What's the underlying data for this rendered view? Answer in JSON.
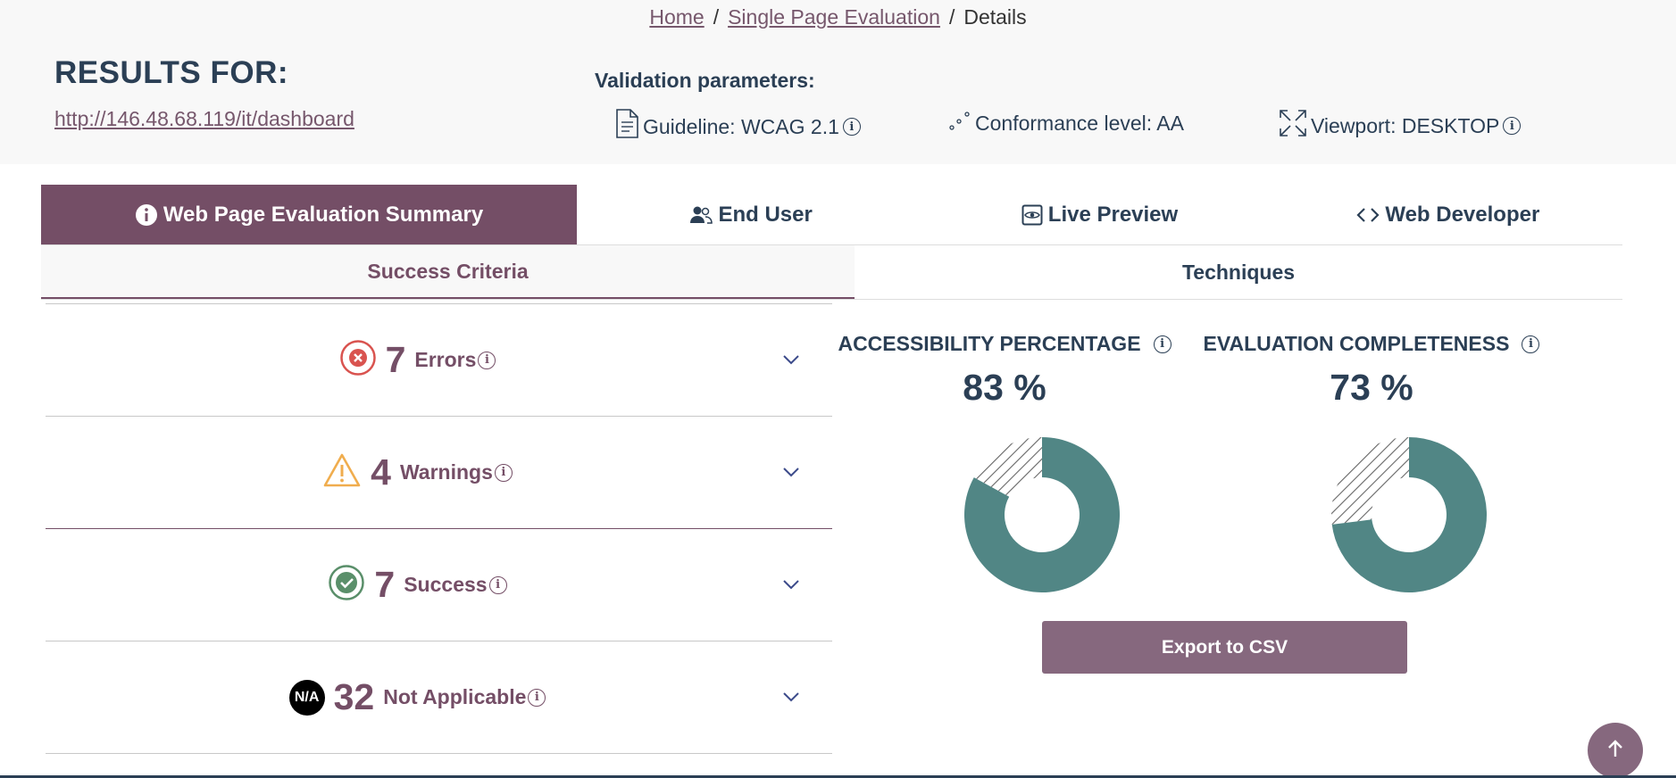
{
  "breadcrumb": {
    "home": "Home",
    "single_page": "Single Page Evaluation",
    "current": "Details",
    "separator": "/"
  },
  "results": {
    "title": "RESULTS FOR:",
    "url": "http://146.48.68.119/it/dashboard"
  },
  "params": {
    "title": "Validation parameters:",
    "guideline": "Guideline: WCAG 2.1",
    "conformance": "Conformance level: AA",
    "viewport": "Viewport: DESKTOP"
  },
  "tabs": [
    {
      "label": "Web Page Evaluation Summary",
      "active": true,
      "icon": "info-icon"
    },
    {
      "label": "End User",
      "active": false,
      "icon": "users-icon"
    },
    {
      "label": "Live Preview",
      "active": false,
      "icon": "eye-icon"
    },
    {
      "label": "Web Developer",
      "active": false,
      "icon": "code-icon"
    }
  ],
  "subtabs": [
    {
      "label": "Success Criteria",
      "active": true
    },
    {
      "label": "Techniques",
      "active": false
    }
  ],
  "rows": [
    {
      "count": "7",
      "label": "Errors",
      "icon": "error-x-icon",
      "color": "#d9534f"
    },
    {
      "count": "4",
      "label": "Warnings",
      "icon": "warning-triangle-icon",
      "color": "#f0ad4e"
    },
    {
      "count": "7",
      "label": "Success",
      "icon": "success-check-icon",
      "color": "#5a8f6a"
    },
    {
      "count": "32",
      "label": "Not Applicable",
      "icon": "na-icon",
      "badge": "N/A"
    }
  ],
  "metrics": {
    "accessibility": {
      "title": "ACCESSIBILITY PERCENTAGE",
      "value": "83 %",
      "percent": 83
    },
    "completeness": {
      "title": "EVALUATION COMPLETENESS",
      "value": "73 %",
      "percent": 73
    }
  },
  "export_label": "Export to CSV",
  "colors": {
    "brand": "#744e66",
    "donut_fill": "#518685",
    "heading": "#2b3f55",
    "button": "#86687e"
  }
}
